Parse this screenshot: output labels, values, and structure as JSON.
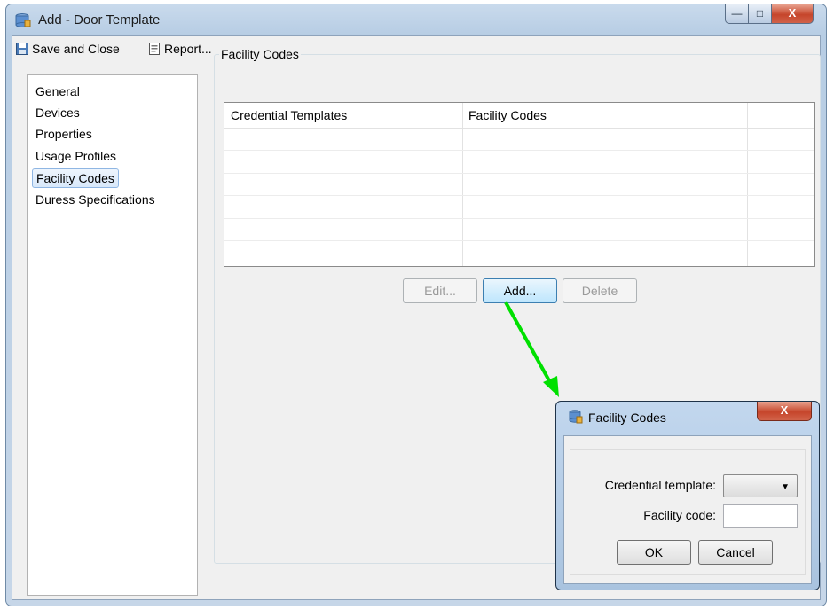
{
  "window": {
    "title": "Add - Door Template",
    "min_glyph": "—",
    "max_glyph": "□",
    "close_glyph": "X"
  },
  "toolbar": {
    "save_close_label": "Save and Close",
    "report_label": "Report..."
  },
  "nav": {
    "items": [
      {
        "label": "General"
      },
      {
        "label": "Devices"
      },
      {
        "label": "Properties"
      },
      {
        "label": "Usage Profiles"
      },
      {
        "label": "Facility Codes",
        "selected": true
      },
      {
        "label": "Duress Specifications"
      }
    ]
  },
  "section": {
    "title": "Facility Codes",
    "columns": [
      "Credential Templates",
      "Facility Codes"
    ],
    "rows": []
  },
  "actions": {
    "edit_label": "Edit...",
    "add_label": "Add...",
    "delete_label": "Delete"
  },
  "dialog": {
    "title": "Facility Codes",
    "close_glyph": "X",
    "credential_template_label": "Credential template:",
    "credential_template_value": "",
    "facility_code_label": "Facility code:",
    "facility_code_value": "",
    "ok_label": "OK",
    "cancel_label": "Cancel"
  },
  "colors": {
    "annotation_arrow": "#00e000",
    "selection": "#d8e8fa",
    "close_button": "#c6452b"
  }
}
